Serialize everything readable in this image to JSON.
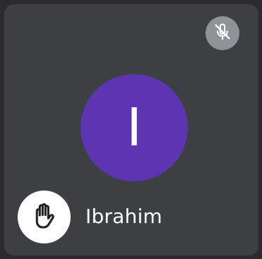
{
  "participant": {
    "name": "Ibrahim",
    "initial": "I",
    "avatar_color": "#5e35b1",
    "muted": true,
    "hand_raised": true
  },
  "icons": {
    "mute": "microphone-off-icon",
    "hand": "raised-hand-icon"
  },
  "colors": {
    "tile_background": "#3c4043",
    "mute_badge": "#8f9297",
    "hand_badge": "#ffffff",
    "text": "#ffffff"
  }
}
